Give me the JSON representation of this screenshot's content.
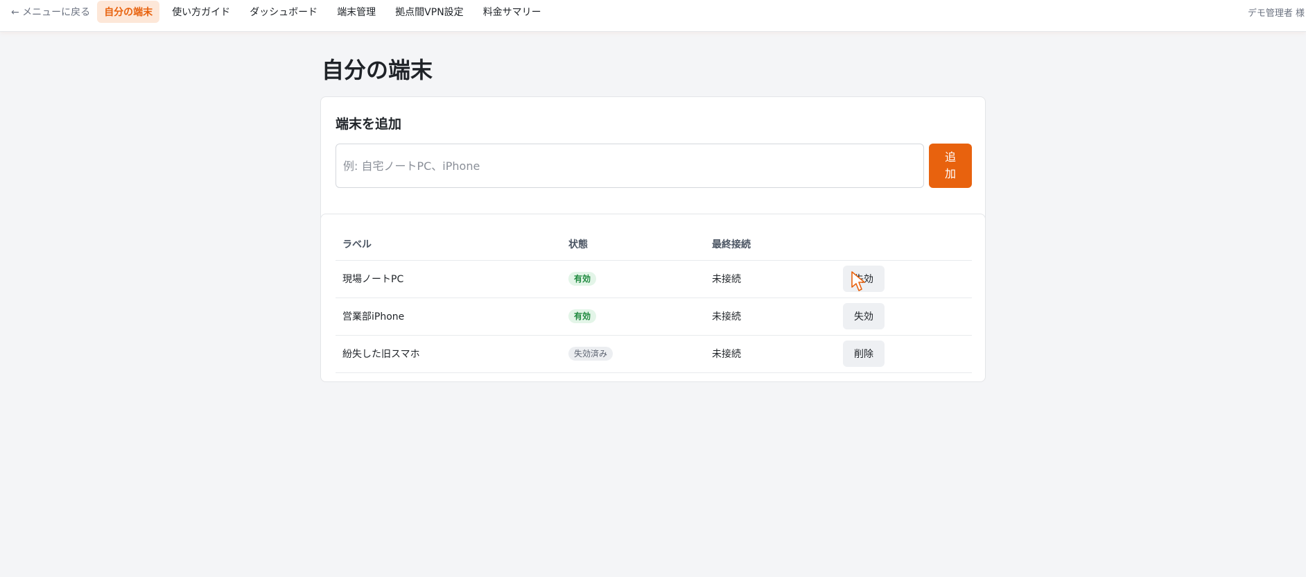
{
  "nav": {
    "back_label": "← メニューに戻る",
    "links": [
      {
        "label": "自分の端末",
        "active": true
      },
      {
        "label": "使い方ガイド",
        "active": false
      },
      {
        "label": "ダッシュボード",
        "active": false
      },
      {
        "label": "端末管理",
        "active": false
      },
      {
        "label": "拠点間VPN設定",
        "active": false
      },
      {
        "label": "料金サマリー",
        "active": false
      }
    ],
    "user_label": "デモ管理者 様"
  },
  "page": {
    "title": "自分の端末"
  },
  "add_card": {
    "title": "端末を追加",
    "input_value": "",
    "input_placeholder": "例: 自宅ノートPC、iPhone",
    "add_button_label": "追加"
  },
  "devices": {
    "columns": [
      "ラベル",
      "状態",
      "最終接続",
      ""
    ],
    "rows": [
      {
        "label": "現場ノートPC",
        "status": "有効",
        "status_type": "active",
        "last_connection": "未接続",
        "action": "失効"
      },
      {
        "label": "営業部iPhone",
        "status": "有効",
        "status_type": "active",
        "last_connection": "未接続",
        "action": "失効"
      },
      {
        "label": "紛失した旧スマホ",
        "status": "失効済み",
        "status_type": "revoked",
        "last_connection": "未接続",
        "action": "削除"
      }
    ]
  },
  "colors": {
    "accent": "#e8620e",
    "accent_soft": "#fde7d8",
    "active_badge_bg": "#e3f5e8",
    "active_badge_text": "#1f8a3f",
    "revoked_badge_bg": "#eceef1",
    "page_bg": "#f4f5f7"
  },
  "icons": {
    "cursor": "mouse-pointer-icon"
  }
}
